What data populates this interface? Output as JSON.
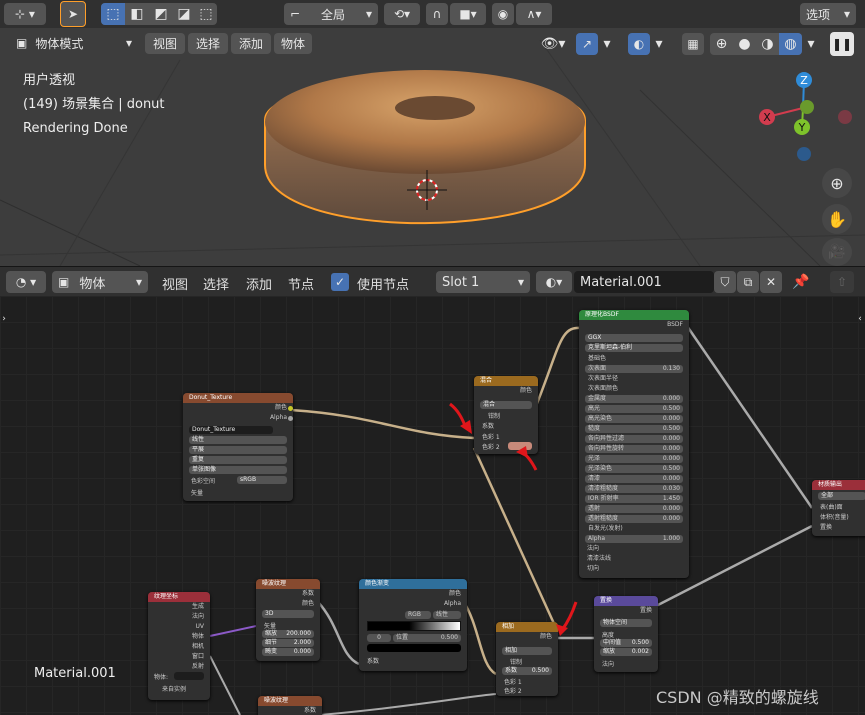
{
  "viewport_header": {
    "orientation_label": "全局",
    "options_label": "选项",
    "mode_label": "物体模式",
    "menus": [
      "视图",
      "选择",
      "添加",
      "物体"
    ]
  },
  "viewport": {
    "overlay_lines": [
      "用户透视",
      "(149) 场景集合 | donut",
      "Rendering Done"
    ],
    "gizmo": {
      "z": "Z",
      "y": "Y",
      "x": "X"
    }
  },
  "node_header": {
    "type_label": "物体",
    "menus": [
      "视图",
      "选择",
      "添加",
      "节点"
    ],
    "use_nodes_label": "使用节点",
    "use_nodes_checked": true,
    "slot_label": "Slot 1",
    "material_name": "Material.001"
  },
  "node_editor": {
    "material_label": "Material.001",
    "watermark": "CSDN @精致的螺旋线"
  },
  "nodes": {
    "image_texture": {
      "title": "Donut_Texture",
      "out1": "颜色",
      "out2": "Alpha",
      "image": "Donut_Texture",
      "interp": "线性",
      "proj": "平展",
      "ext": "重复",
      "source": "单张图像",
      "colorspace_label": "色彩空间",
      "colorspace": "sRGB",
      "vector": "矢量"
    },
    "mix": {
      "title": "混合",
      "out": "颜色",
      "mode": "混合",
      "clamp": "钳制",
      "fac": "系数",
      "c1": "色彩 1",
      "c2": "色彩 2"
    },
    "bsdf": {
      "title": "原理化BSDF",
      "out": "BSDF",
      "dist": "GGX",
      "sss": "克里斯坦森-伯利",
      "rows": [
        {
          "label": "基础色",
          "value": ""
        },
        {
          "label": "次表面",
          "value": "0.130"
        },
        {
          "label": "次表面半径",
          "value": ""
        },
        {
          "label": "次表面颜色",
          "value": ""
        },
        {
          "label": "金属度",
          "value": "0.000"
        },
        {
          "label": "高光",
          "value": "0.500"
        },
        {
          "label": "高光染色",
          "value": "0.000"
        },
        {
          "label": "糙度",
          "value": "0.500"
        },
        {
          "label": "各向异性过滤",
          "value": "0.000"
        },
        {
          "label": "各向异性旋转",
          "value": "0.000"
        },
        {
          "label": "光泽",
          "value": "0.000"
        },
        {
          "label": "光泽染色",
          "value": "0.500"
        },
        {
          "label": "清漆",
          "value": "0.000"
        },
        {
          "label": "清漆粗糙度",
          "value": "0.030"
        },
        {
          "label": "IOR 折射率",
          "value": "1.450"
        },
        {
          "label": "透射",
          "value": "0.000"
        },
        {
          "label": "透射粗糙度",
          "value": "0.000"
        },
        {
          "label": "自发光(发射)",
          "value": ""
        },
        {
          "label": "Alpha",
          "value": "1.000"
        }
      ],
      "inputs": [
        "法向",
        "清漆法线",
        "切向"
      ]
    },
    "material_output": {
      "title": "材质输出",
      "target": "全部",
      "in1": "表(曲)面",
      "in2": "体积(音量)",
      "in3": "置换"
    },
    "texcoord": {
      "title": "纹理坐标",
      "outs": [
        "生成",
        "法向",
        "UV",
        "物体",
        "相机",
        "窗口",
        "反射"
      ],
      "object_label": "物体:",
      "from_instancer": "来自实例"
    },
    "noise1": {
      "title": "噪波纹理",
      "out1": "系数",
      "out2": "颜色",
      "dim": "3D",
      "vector": "矢量",
      "scale_label": "缩放",
      "scale": "200.000",
      "detail_label": "细节",
      "detail": "2.000",
      "distortion_label": "畸变",
      "distortion": "0.000"
    },
    "colorramp": {
      "title": "颜色渐变",
      "out1": "颜色",
      "out2": "Alpha",
      "mode": "RGB",
      "interp": "线性",
      "index": "0",
      "pos_label": "位置",
      "pos": "0.500",
      "fac": "系数"
    },
    "multiply": {
      "title": "相加",
      "out": "颜色",
      "mode": "相加",
      "clamp": "钳制",
      "fac": "系数",
      "fac_value": "0.500",
      "c1": "色彩 1",
      "c2": "色彩 2"
    },
    "displacement": {
      "title": "置换",
      "out": "置换",
      "space": "物体空间",
      "height": "高度",
      "mid_label": "中间值",
      "mid": "0.500",
      "scale_label": "缩放",
      "scale": "0.002",
      "normal": "法向"
    },
    "noise2": {
      "title": "噪波纹理",
      "out1": "系数"
    }
  },
  "colors": {
    "selection": "#ff9f2a",
    "accent_blue": "#4772b3",
    "annotation_red": "#e0161b"
  }
}
